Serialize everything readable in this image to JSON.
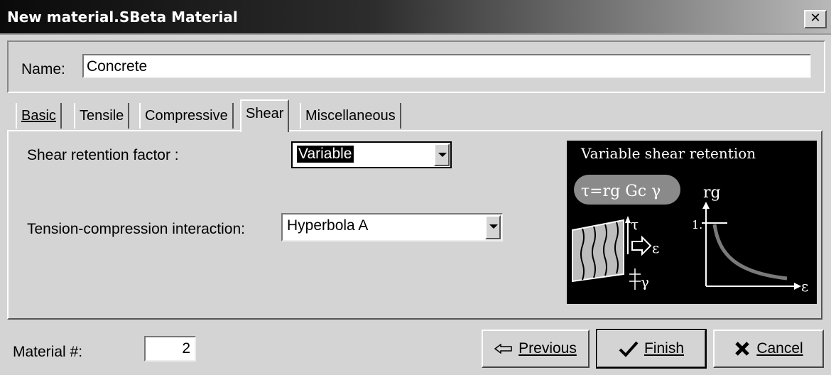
{
  "window": {
    "title": "New material.SBeta Material",
    "close_glyph": "✕"
  },
  "name_field": {
    "label": "Name:",
    "value": "Concrete"
  },
  "tabs": [
    {
      "label": "Basic"
    },
    {
      "label": "Tensile"
    },
    {
      "label": "Compressive"
    },
    {
      "label": "Shear",
      "active": true
    },
    {
      "label": "Miscellaneous"
    }
  ],
  "shear": {
    "retention_label": "Shear retention factor :",
    "retention_value": "Variable",
    "interaction_label": "Tension-compression interaction:",
    "interaction_value": "Hyperbola A"
  },
  "diagram": {
    "title": "Variable shear retention",
    "formula": "τ=rg Gc γ",
    "y_axis_label": "rg",
    "x_axis_label": "ε",
    "tick_label": "1.",
    "tau_label": "τ",
    "eps_label": "ε",
    "gamma_label": "γ"
  },
  "footer": {
    "material_label": "Material #:",
    "material_value": "2",
    "previous_label": "Previous",
    "finish_label": "Finish",
    "cancel_label": "Cancel"
  },
  "icons": {
    "previous": "left-arrow-icon",
    "finish": "checkmark-icon",
    "cancel": "x-icon"
  }
}
